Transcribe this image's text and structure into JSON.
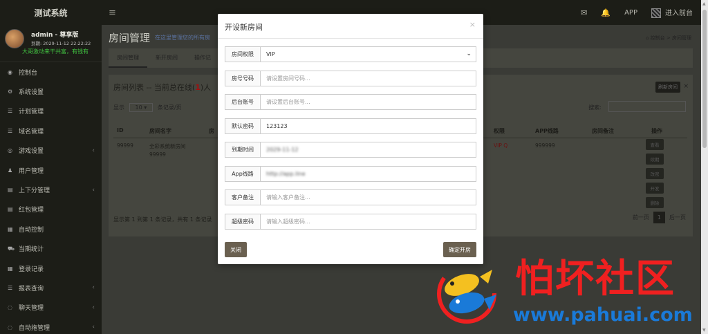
{
  "topbar": {
    "brand": "测试系统",
    "hamburger": "≡",
    "app_label": "APP",
    "front_label": "进入前台"
  },
  "user": {
    "name": "admin - 尊享版",
    "expiry": "到期: 2029-11-12 22:22:22",
    "marquee": "大哥激动来干共富，有钱有"
  },
  "sidebar": {
    "items": [
      {
        "label": "控制台",
        "icon": "dashboard-icon",
        "has_sub": false
      },
      {
        "label": "系统设置",
        "icon": "gears-icon",
        "has_sub": false
      },
      {
        "label": "计划管理",
        "icon": "list-icon",
        "has_sub": false
      },
      {
        "label": "域名管理",
        "icon": "list-icon",
        "has_sub": false
      },
      {
        "label": "游戏设置",
        "icon": "gamepad-icon",
        "has_sub": true
      },
      {
        "label": "用户管理",
        "icon": "user-icon",
        "has_sub": false
      },
      {
        "label": "上下分管理",
        "icon": "file-icon",
        "has_sub": true
      },
      {
        "label": "红包管理",
        "icon": "file-icon",
        "has_sub": false
      },
      {
        "label": "自动控制",
        "icon": "table-icon",
        "has_sub": false
      },
      {
        "label": "当期统计",
        "icon": "cart-icon",
        "has_sub": false
      },
      {
        "label": "登录记录",
        "icon": "table-icon",
        "has_sub": false
      },
      {
        "label": "报表查询",
        "icon": "list-icon",
        "has_sub": true
      },
      {
        "label": "聊天管理",
        "icon": "chat-icon",
        "has_sub": true
      },
      {
        "label": "自动拖管理",
        "icon": "chat-icon",
        "has_sub": true
      }
    ]
  },
  "main": {
    "title": "房间管理",
    "subtitle": "在这里管理您的所有房",
    "breadcrumb_home": "控制台",
    "breadcrumb_current": "房间管理",
    "tabs": [
      "房间管理",
      "新开房间",
      "操作记"
    ],
    "panel": {
      "title_prefix": "房间列表 -- 当前总在线(",
      "online": "1",
      "title_suffix": ")人",
      "button": "刷新房间",
      "close": "×",
      "show": "显示",
      "page_size": "10",
      "records_per_page": "条记录/页",
      "search": "搜索:",
      "columns": [
        "ID",
        "房间名字",
        "房",
        "权限",
        "APP线路",
        "房间备注",
        "操作"
      ],
      "row": {
        "id": "99999",
        "name": "全彩系统新房间99999",
        "permission": "VIP Q",
        "app_line": "999999",
        "ops": [
          "查看",
          "续期",
          "改密",
          "开发",
          "删除"
        ]
      },
      "footer": "显示第 1 到第 1 条记录，共有 1 条记录",
      "prev": "前一页",
      "page": "1",
      "next": "后一页"
    }
  },
  "modal": {
    "title": "开设新房间",
    "close": "×",
    "fields": [
      {
        "label": "房间权限",
        "type": "select",
        "value": "VIP"
      },
      {
        "label": "房号号码",
        "type": "input",
        "value": "",
        "placeholder": "请设置房间号码..."
      },
      {
        "label": "后台账号",
        "type": "input",
        "value": "",
        "placeholder": "请设置后台账号..."
      },
      {
        "label": "默认密码",
        "type": "input",
        "value": "123123",
        "placeholder": ""
      },
      {
        "label": "到期时间",
        "type": "blurred",
        "value": "2029-11-12"
      },
      {
        "label": "App线路",
        "type": "blurred",
        "value": "http://app.line"
      },
      {
        "label": "客户备注",
        "type": "input",
        "value": "",
        "placeholder": "请输入客户备注..."
      },
      {
        "label": "超级密码",
        "type": "input",
        "value": "",
        "placeholder": "请输入超级密码..."
      }
    ],
    "close_button": "关闭",
    "confirm_button": "确定开房"
  },
  "watermark": {
    "text": "怕坏社区",
    "url": "www.pahuai.com"
  },
  "colors": {
    "modal_button": "#6a6050",
    "watermark_red": "#f02020",
    "watermark_blue": "#1a7ad8",
    "marquee_green": "#40c040"
  }
}
